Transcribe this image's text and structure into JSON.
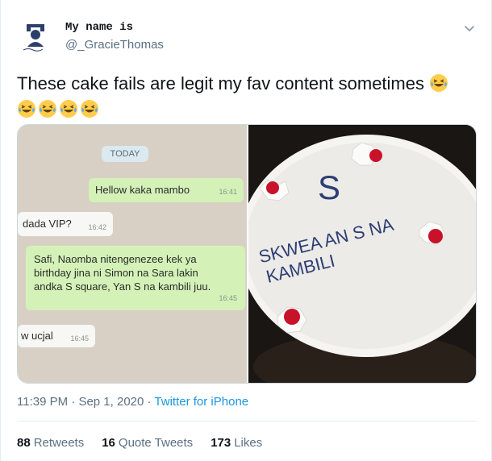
{
  "author": {
    "name": "My name is",
    "handle": "@_GracieThomas"
  },
  "tweet": {
    "text": "These cake fails are legit my fav content sometimes"
  },
  "chat_screenshot": {
    "date_label": "TODAY",
    "messages": [
      {
        "dir": "out",
        "text": "Hellow kaka mambo",
        "time": "16:41"
      },
      {
        "dir": "in",
        "text": "dada VIP?",
        "time": "16:42"
      },
      {
        "dir": "out",
        "lines": [
          "Safi, Naomba nitengenezee kek ya",
          "birthday jina ni Simon na Sara lakin",
          "andka S square, Yan S na kambili juu."
        ],
        "time": "16:45"
      },
      {
        "dir": "in",
        "text": "w ucjal",
        "time": "16:45"
      }
    ]
  },
  "cake_photo": {
    "icing_lines": [
      "S",
      "SKWEA AN S NA",
      "KAMBILI"
    ]
  },
  "meta": {
    "time": "11:39 PM",
    "date": "Sep 1, 2020",
    "source": "Twitter for iPhone"
  },
  "stats": {
    "retweets_count": "88",
    "retweets_label": "Retweets",
    "quotes_count": "16",
    "quotes_label": "Quote Tweets",
    "likes_count": "173",
    "likes_label": "Likes"
  }
}
